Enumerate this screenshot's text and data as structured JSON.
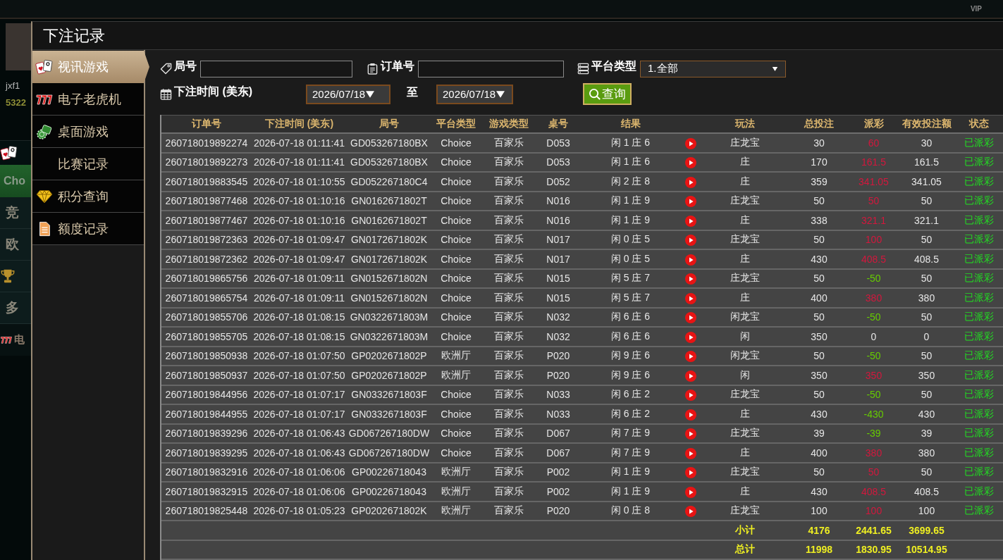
{
  "backdrop": {
    "badge": "VIP",
    "username": "jxf1",
    "balance": "5322",
    "menu": [
      {
        "label": "Cho",
        "kind": "banner"
      },
      {
        "label": "竞",
        "kind": "row"
      },
      {
        "label": "欧",
        "kind": "row"
      },
      {
        "label": "多",
        "kind": "row"
      },
      {
        "label": "电",
        "kind": "slot"
      }
    ]
  },
  "dialog": {
    "title": "下注记录"
  },
  "sidebar": {
    "items": [
      {
        "label": "视讯游戏",
        "selected": true
      },
      {
        "label": "电子老虎机",
        "selected": false
      },
      {
        "label": "桌面游戏",
        "selected": false
      },
      {
        "label": "比赛记录",
        "selected": false
      },
      {
        "label": "积分查询",
        "selected": false
      },
      {
        "label": "额度记录",
        "selected": false
      }
    ]
  },
  "filters": {
    "round_no": {
      "label": "局号"
    },
    "order_no": {
      "label": "订单号"
    },
    "platform": {
      "label": "平台类型",
      "value": "1.全部"
    },
    "bet_time": {
      "label": "下注时间 (美东)",
      "from": "2026/07/18",
      "separator": "至",
      "to": "2026/07/18"
    },
    "query_button": {
      "label": "查询"
    }
  },
  "table": {
    "columns": [
      "订单号",
      "下注时间 (美东)",
      "局号",
      "平台类型",
      "游戏类型",
      "桌号",
      "结果",
      "玩法",
      "总投注",
      "派彩",
      "有效投注额",
      "状态"
    ],
    "rows": [
      {
        "order_no": "260718019892274",
        "bet_time": "2026-07-18 01:11:41",
        "round_no": "GD053267180BX",
        "platform": "Choice",
        "game_type": "百家乐",
        "table_no": "D053",
        "result": "闲 1 庄 6",
        "bet_type": "庄龙宝",
        "total_bet": "30",
        "payout": {
          "text": "60",
          "color": "#d4173d"
        },
        "valid_bet": "30",
        "status": "已派彩"
      },
      {
        "order_no": "260718019892273",
        "bet_time": "2026-07-18 01:11:41",
        "round_no": "GD053267180BX",
        "platform": "Choice",
        "game_type": "百家乐",
        "table_no": "D053",
        "result": "闲 1 庄 6",
        "bet_type": "庄",
        "total_bet": "170",
        "payout": {
          "text": "161.5",
          "color": "#d4173d"
        },
        "valid_bet": "161.5",
        "status": "已派彩"
      },
      {
        "order_no": "260718019883545",
        "bet_time": "2026-07-18 01:10:55",
        "round_no": "GD052267180C4",
        "platform": "Choice",
        "game_type": "百家乐",
        "table_no": "D052",
        "result": "闲 2 庄 8",
        "bet_type": "庄",
        "total_bet": "359",
        "payout": {
          "text": "341.05",
          "color": "#d4173d"
        },
        "valid_bet": "341.05",
        "status": "已派彩"
      },
      {
        "order_no": "260718019877468",
        "bet_time": "2026-07-18 01:10:16",
        "round_no": "GN0162671802T",
        "platform": "Choice",
        "game_type": "百家乐",
        "table_no": "N016",
        "result": "闲 1 庄 9",
        "bet_type": "庄龙宝",
        "total_bet": "50",
        "payout": {
          "text": "50",
          "color": "#d4173d"
        },
        "valid_bet": "50",
        "status": "已派彩"
      },
      {
        "order_no": "260718019877467",
        "bet_time": "2026-07-18 01:10:16",
        "round_no": "GN0162671802T",
        "platform": "Choice",
        "game_type": "百家乐",
        "table_no": "N016",
        "result": "闲 1 庄 9",
        "bet_type": "庄",
        "total_bet": "338",
        "payout": {
          "text": "321.1",
          "color": "#d4173d"
        },
        "valid_bet": "321.1",
        "status": "已派彩"
      },
      {
        "order_no": "260718019872363",
        "bet_time": "2026-07-18 01:09:47",
        "round_no": "GN0172671802K",
        "platform": "Choice",
        "game_type": "百家乐",
        "table_no": "N017",
        "result": "闲 0 庄 5",
        "bet_type": "庄龙宝",
        "total_bet": "50",
        "payout": {
          "text": "100",
          "color": "#d4173d"
        },
        "valid_bet": "50",
        "status": "已派彩"
      },
      {
        "order_no": "260718019872362",
        "bet_time": "2026-07-18 01:09:47",
        "round_no": "GN0172671802K",
        "platform": "Choice",
        "game_type": "百家乐",
        "table_no": "N017",
        "result": "闲 0 庄 5",
        "bet_type": "庄",
        "total_bet": "430",
        "payout": {
          "text": "408.5",
          "color": "#d4173d"
        },
        "valid_bet": "408.5",
        "status": "已派彩"
      },
      {
        "order_no": "260718019865756",
        "bet_time": "2026-07-18 01:09:11",
        "round_no": "GN0152671802N",
        "platform": "Choice",
        "game_type": "百家乐",
        "table_no": "N015",
        "result": "闲 5 庄 7",
        "bet_type": "庄龙宝",
        "total_bet": "50",
        "payout": {
          "text": "-50",
          "color": "#66cc00"
        },
        "valid_bet": "50",
        "status": "已派彩"
      },
      {
        "order_no": "260718019865754",
        "bet_time": "2026-07-18 01:09:11",
        "round_no": "GN0152671802N",
        "platform": "Choice",
        "game_type": "百家乐",
        "table_no": "N015",
        "result": "闲 5 庄 7",
        "bet_type": "庄",
        "total_bet": "400",
        "payout": {
          "text": "380",
          "color": "#d4173d"
        },
        "valid_bet": "380",
        "status": "已派彩"
      },
      {
        "order_no": "260718019855706",
        "bet_time": "2026-07-18 01:08:15",
        "round_no": "GN0322671803M",
        "platform": "Choice",
        "game_type": "百家乐",
        "table_no": "N032",
        "result": "闲 6 庄 6",
        "bet_type": "闲龙宝",
        "total_bet": "50",
        "payout": {
          "text": "-50",
          "color": "#66cc00"
        },
        "valid_bet": "50",
        "status": "已派彩"
      },
      {
        "order_no": "260718019855705",
        "bet_time": "2026-07-18 01:08:15",
        "round_no": "GN0322671803M",
        "platform": "Choice",
        "game_type": "百家乐",
        "table_no": "N032",
        "result": "闲 6 庄 6",
        "bet_type": "闲",
        "total_bet": "350",
        "payout": {
          "text": "0",
          "color": "#e6e6e6"
        },
        "valid_bet": "0",
        "status": "已派彩"
      },
      {
        "order_no": "260718019850938",
        "bet_time": "2026-07-18 01:07:50",
        "round_no": "GP0202671802P",
        "platform": "欧洲厅",
        "game_type": "百家乐",
        "table_no": "P020",
        "result": "闲 9 庄 6",
        "bet_type": "闲龙宝",
        "total_bet": "50",
        "payout": {
          "text": "-50",
          "color": "#66cc00"
        },
        "valid_bet": "50",
        "status": "已派彩"
      },
      {
        "order_no": "260718019850937",
        "bet_time": "2026-07-18 01:07:50",
        "round_no": "GP0202671802P",
        "platform": "欧洲厅",
        "game_type": "百家乐",
        "table_no": "P020",
        "result": "闲 9 庄 6",
        "bet_type": "闲",
        "total_bet": "350",
        "payout": {
          "text": "350",
          "color": "#d4173d"
        },
        "valid_bet": "350",
        "status": "已派彩"
      },
      {
        "order_no": "260718019844956",
        "bet_time": "2026-07-18 01:07:17",
        "round_no": "GN0332671803F",
        "platform": "Choice",
        "game_type": "百家乐",
        "table_no": "N033",
        "result": "闲 6 庄 2",
        "bet_type": "庄龙宝",
        "total_bet": "50",
        "payout": {
          "text": "-50",
          "color": "#66cc00"
        },
        "valid_bet": "50",
        "status": "已派彩"
      },
      {
        "order_no": "260718019844955",
        "bet_time": "2026-07-18 01:07:17",
        "round_no": "GN0332671803F",
        "platform": "Choice",
        "game_type": "百家乐",
        "table_no": "N033",
        "result": "闲 6 庄 2",
        "bet_type": "庄",
        "total_bet": "430",
        "payout": {
          "text": "-430",
          "color": "#66cc00"
        },
        "valid_bet": "430",
        "status": "已派彩"
      },
      {
        "order_no": "260718019839296",
        "bet_time": "2026-07-18 01:06:43",
        "round_no": "GD067267180DW",
        "platform": "Choice",
        "game_type": "百家乐",
        "table_no": "D067",
        "result": "闲 7 庄 9",
        "bet_type": "庄龙宝",
        "total_bet": "39",
        "payout": {
          "text": "-39",
          "color": "#66cc00"
        },
        "valid_bet": "39",
        "status": "已派彩"
      },
      {
        "order_no": "260718019839295",
        "bet_time": "2026-07-18 01:06:43",
        "round_no": "GD067267180DW",
        "platform": "Choice",
        "game_type": "百家乐",
        "table_no": "D067",
        "result": "闲 7 庄 9",
        "bet_type": "庄",
        "total_bet": "400",
        "payout": {
          "text": "380",
          "color": "#d4173d"
        },
        "valid_bet": "380",
        "status": "已派彩"
      },
      {
        "order_no": "260718019832916",
        "bet_time": "2026-07-18 01:06:06",
        "round_no": "GP00226718043",
        "platform": "欧洲厅",
        "game_type": "百家乐",
        "table_no": "P002",
        "result": "闲 1 庄 9",
        "bet_type": "庄龙宝",
        "total_bet": "50",
        "payout": {
          "text": "50",
          "color": "#d4173d"
        },
        "valid_bet": "50",
        "status": "已派彩"
      },
      {
        "order_no": "260718019832915",
        "bet_time": "2026-07-18 01:06:06",
        "round_no": "GP00226718043",
        "platform": "欧洲厅",
        "game_type": "百家乐",
        "table_no": "P002",
        "result": "闲 1 庄 9",
        "bet_type": "庄",
        "total_bet": "430",
        "payout": {
          "text": "408.5",
          "color": "#d4173d"
        },
        "valid_bet": "408.5",
        "status": "已派彩"
      },
      {
        "order_no": "260718019825448",
        "bet_time": "2026-07-18 01:05:23",
        "round_no": "GP0202671802K",
        "platform": "欧洲厅",
        "game_type": "百家乐",
        "table_no": "P020",
        "result": "闲 0 庄 8",
        "bet_type": "庄龙宝",
        "total_bet": "100",
        "payout": {
          "text": "100",
          "color": "#d4173d"
        },
        "valid_bet": "100",
        "status": "已派彩"
      }
    ],
    "totals": [
      {
        "label": "小计",
        "total_bet": "4176",
        "payout": "2441.65",
        "valid_bet": "3699.65"
      },
      {
        "label": "总计",
        "total_bet": "11998",
        "payout": "1830.95",
        "valid_bet": "10514.95"
      }
    ]
  }
}
